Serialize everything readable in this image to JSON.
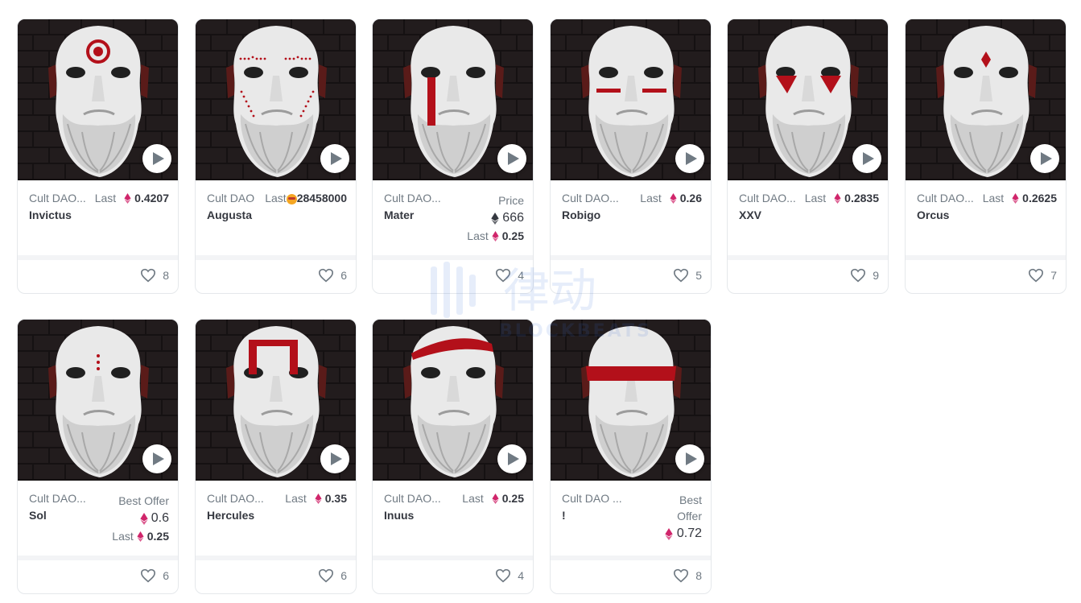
{
  "colors": {
    "accent_eth": "#d0266b",
    "text": "#353840",
    "muted": "#707a83",
    "paint_red": "#b3101a",
    "bg_dark": "#1b1718"
  },
  "watermark": {
    "cn": "律动",
    "en": "BLOCKBEATS"
  },
  "cards": [
    {
      "collection": "Cult DAO...",
      "name": "Invictus",
      "price_mode": "last",
      "last_label": "Last",
      "last_value": "0.4207",
      "likes": "8",
      "paint": "target"
    },
    {
      "collection": "Cult DAO",
      "name": "Augusta",
      "price_mode": "last-emoji",
      "last_label": "Last",
      "last_value": "28458000",
      "likes": "6",
      "paint": "dots"
    },
    {
      "collection": "Cult DAO...",
      "name": "Mater",
      "price_mode": "price",
      "price_label": "Price",
      "price_value": "666",
      "last_label": "Last",
      "last_value": "0.25",
      "likes": "4",
      "paint": "tear"
    },
    {
      "collection": "Cult DAO...",
      "name": "Robigo",
      "price_mode": "last",
      "last_label": "Last",
      "last_value": "0.26",
      "likes": "5",
      "paint": "brows"
    },
    {
      "collection": "Cult DAO...",
      "name": "XXV",
      "price_mode": "last",
      "last_label": "Last",
      "last_value": "0.2835",
      "likes": "9",
      "paint": "triangles"
    },
    {
      "collection": "Cult DAO...",
      "name": "Orcus",
      "price_mode": "last",
      "last_label": "Last",
      "last_value": "0.2625",
      "likes": "7",
      "paint": "diamond"
    },
    {
      "collection": "Cult DAO...",
      "name": "Sol",
      "price_mode": "offer",
      "offer_label": "Best Offer",
      "offer_value": "0.6",
      "last_label": "Last",
      "last_value": "0.25",
      "likes": "6",
      "paint": "vdots"
    },
    {
      "collection": "Cult DAO...",
      "name": "Hercules",
      "price_mode": "last",
      "last_label": "Last",
      "last_value": "0.35",
      "likes": "6",
      "paint": "bars"
    },
    {
      "collection": "Cult DAO...",
      "name": "Inuus",
      "price_mode": "last",
      "last_label": "Last",
      "last_value": "0.25",
      "likes": "4",
      "paint": "head"
    },
    {
      "collection": "Cult DAO ...",
      "name": "!",
      "price_mode": "offer2",
      "offer_label_1": "Best",
      "offer_label_2": "Offer",
      "offer_value": "0.72",
      "likes": "8",
      "paint": "mask"
    }
  ]
}
